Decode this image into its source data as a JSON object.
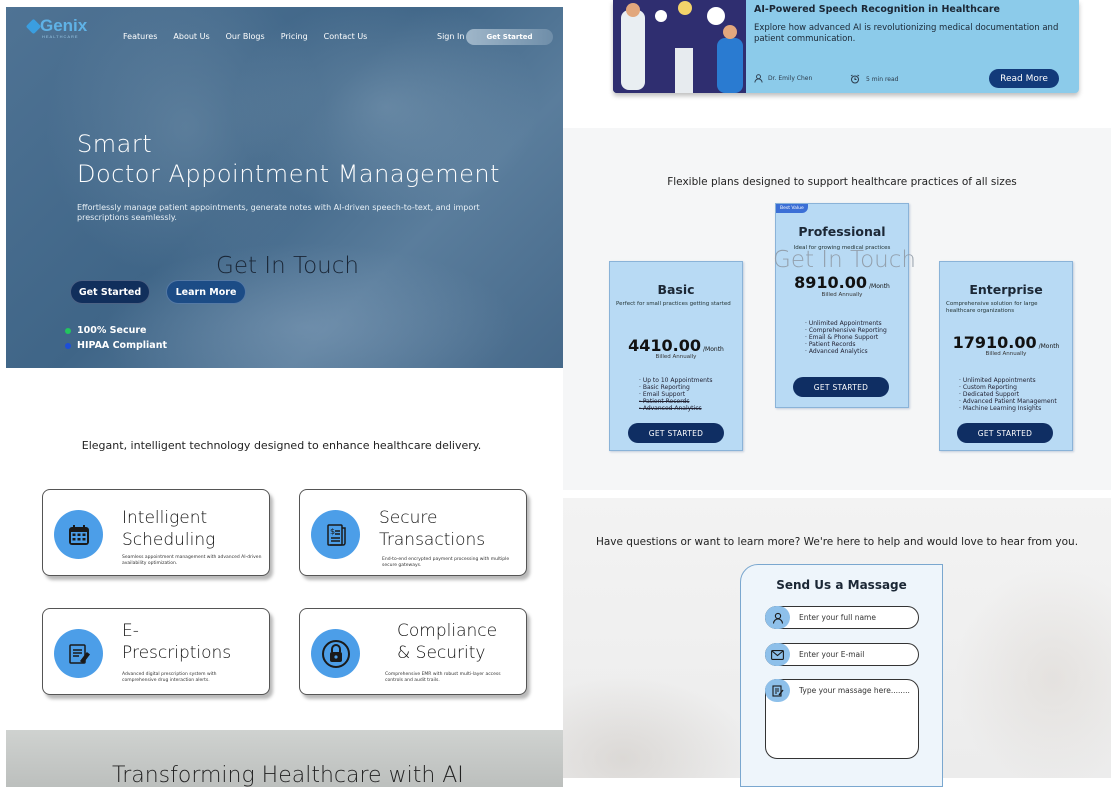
{
  "brand": {
    "name": "Genix",
    "sub": "HEALTHCARE"
  },
  "nav": {
    "items": [
      "Features",
      "About Us",
      "Our Blogs",
      "Pricing",
      "Contact Us"
    ],
    "signin": "Sign In",
    "cta": "Get Started"
  },
  "hero": {
    "title_line1": "Smart",
    "title_line2": "Doctor Appointment Management",
    "description": "Effortlessly manage patient appointments, generate notes with AI-driven speech-to-text, and import prescriptions seamlessly.",
    "get_in_touch": "Get In Touch",
    "primary_button": "Get Started",
    "secondary_button": "Learn More",
    "features": [
      {
        "label": "100% Secure",
        "color": "#22c55e"
      },
      {
        "label": "HIPAA Compliant",
        "color": "#1d4ed8"
      }
    ]
  },
  "services": {
    "tagline": "Elegant, intelligent technology designed to enhance healthcare delivery.",
    "cards": [
      {
        "title1": "Intelligent",
        "title2": "Scheduling",
        "desc": "Seamless appointment management with advanced AI-driven availability optimization.",
        "icon": "calendar-icon"
      },
      {
        "title1": "Secure",
        "title2": "Transactions",
        "desc": "End-to-end encrypted payment processing with multiple secure gateways.",
        "icon": "invoice-icon"
      },
      {
        "title1": "E-",
        "title2": "Prescriptions",
        "desc": "Advanced digital prescription system with comprehensive drug interaction alerts.",
        "icon": "prescription-icon"
      },
      {
        "title1": "Compliance",
        "title2": "& Security",
        "desc": "Comprehensive EMR with robust multi-layer access controls and audit trails.",
        "icon": "lock-icon"
      }
    ]
  },
  "ai_band": {
    "title": "Transforming Healthcare with AI"
  },
  "blog": {
    "title": "AI-Powered Speech Recognition in Healthcare",
    "description": "Explore how advanced AI is revolutionizing medical documentation and patient communication.",
    "author": "Dr. Emily Chen",
    "read_time": "5 min read",
    "button": "Read More"
  },
  "pricing": {
    "subtitle": "Flexible plans designed to support healthcare practices of all sizes",
    "get_in_touch": "Get In Touch",
    "plans": [
      {
        "name": "Basic",
        "desc": "Perfect for small practices getting started",
        "price": "4410.00",
        "per": "/Month",
        "billing": "Billed Annually",
        "features": [
          "Up to 10 Appointments",
          "Basic Reporting",
          "Email Support"
        ],
        "disabled": [
          "Patient Records",
          "Advanced Analytics"
        ],
        "button": "GET STARTED"
      },
      {
        "name": "Professional",
        "badge": "Best Value",
        "desc": "Ideal for growing medical practices",
        "price": "8910.00",
        "per": "/Month",
        "billing": "Billed Annually",
        "features": [
          "Unlimited Appointments",
          "Comprehensive Reporting",
          "Email & Phone Support",
          "Patient Records",
          "Advanced Analytics"
        ],
        "button": "GET STARTED"
      },
      {
        "name": "Enterprise",
        "desc": "Comprehensive solution for large healthcare organizations",
        "price": "17910.00",
        "per": "/Month",
        "billing": "Billed Annually",
        "features": [
          "Unlimited Appointments",
          "Custom Reporting",
          "Dedicated Support",
          "Advanced Patient Management",
          "Machine Learning Insights"
        ],
        "button": "GET STARTED"
      }
    ]
  },
  "contact": {
    "subtitle": "Have questions or want to learn more? We're here to help and would love to hear from you.",
    "form_title": "Send Us a Massage",
    "name_placeholder": "Enter your full name",
    "email_placeholder": "Enter your E-mail",
    "message_placeholder": "Type your massage here........"
  }
}
